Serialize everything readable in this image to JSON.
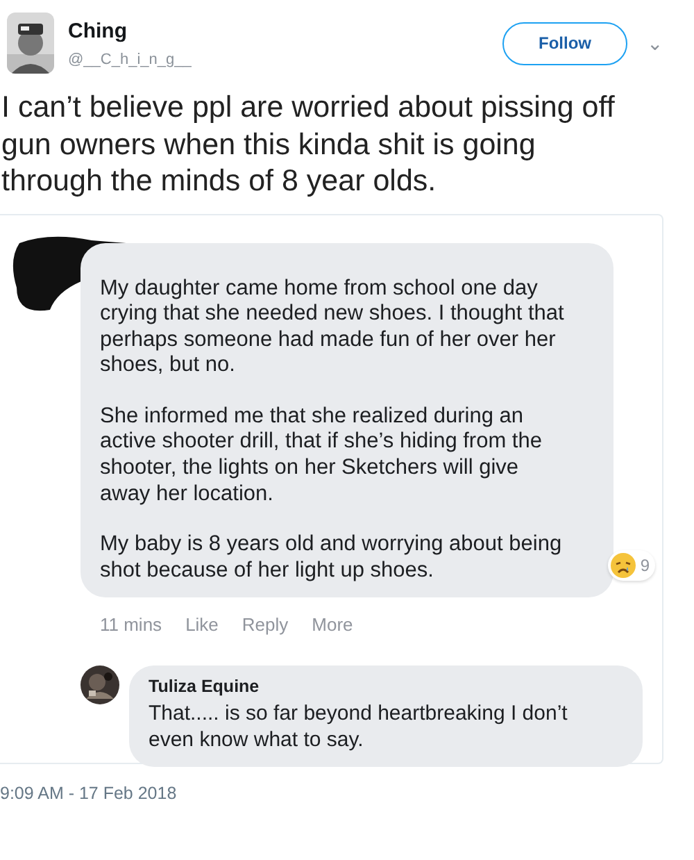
{
  "tweet": {
    "author": {
      "name": "Ching",
      "handle": "@__C_h_i_n_g__"
    },
    "follow_button": "Follow",
    "menu_caret": "⌄",
    "text": "I can’t believe ppl are worried about pissing off gun owners when this kinda shit is going through the minds of 8 year olds.",
    "embedded_screenshot": {
      "comment": {
        "name_redacted": true,
        "paragraphs": [
          "My daughter came home from school one day crying that she needed new shoes. I thought that perhaps someone had made fun of her over her shoes, but no.",
          "She informed me that she realized during an active shooter drill, that if she’s hiding from the shooter, the lights on her Sketchers will give away her location.",
          "My baby is 8 years old and worrying about being shot because of her light up shoes."
        ],
        "reaction_count": "9",
        "time": "11 mins",
        "actions": [
          "Like",
          "Reply",
          "More"
        ]
      },
      "reply": {
        "author": "Tuliza Equine",
        "text": "That..... is so far beyond heartbreaking I don’t even know what to say."
      }
    },
    "timestamp": "9:09 AM - 17 Feb 2018"
  }
}
